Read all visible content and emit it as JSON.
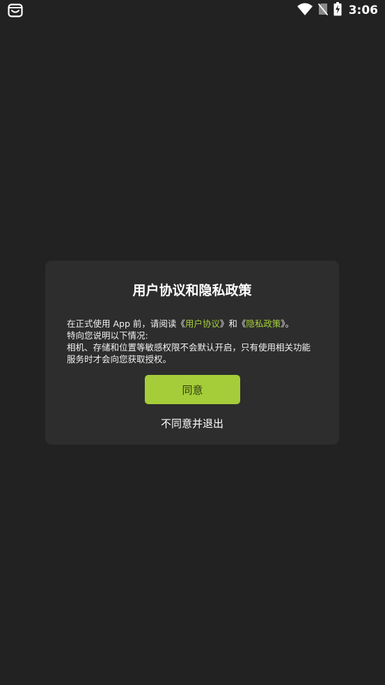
{
  "status_bar": {
    "time": "3:06",
    "icons": [
      "app-notification-icon",
      "wifi-icon",
      "no-sim-icon",
      "battery-charging-icon"
    ]
  },
  "dialog": {
    "title": "用户协议和隐私政策",
    "body": {
      "line1_prefix": "在正式使用 App 前，请阅读《",
      "user_agreement_link": "用户协议",
      "line1_middle": "》和《",
      "privacy_policy_link": "隐私政策",
      "line1_suffix": "》。",
      "line2": "特向您说明以下情况:",
      "line3": "相机、存储和位置等敏感权限不会默认开启，只有使用相关功能服务时才会向您获取授权。"
    },
    "agree_label": "同意",
    "disagree_label": "不同意并退出"
  },
  "colors": {
    "background": "#222222",
    "dialog_background": "#2d2d2d",
    "accent": "#a5cd39",
    "link": "#a5cf3a"
  }
}
